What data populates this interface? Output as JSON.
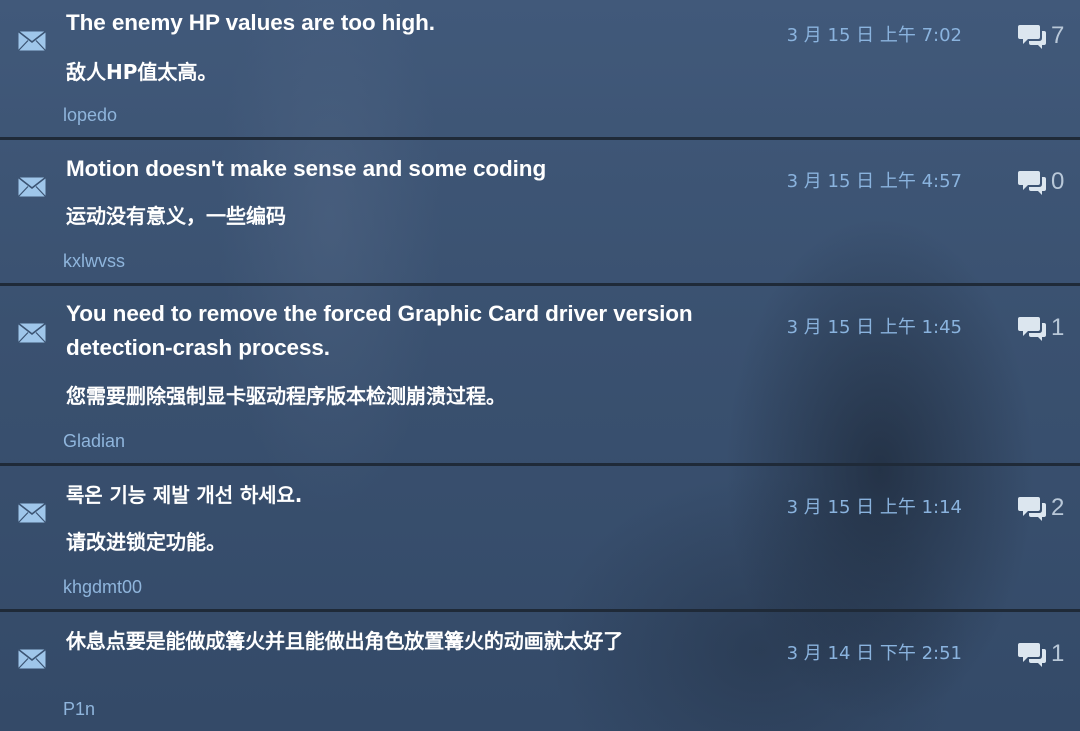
{
  "threads": [
    {
      "title": "The enemy HP values are too high.",
      "translation": "敌人HP值太高。",
      "author": "lopedo",
      "date": "3 月 15 日 上午 7:02",
      "replies": "7"
    },
    {
      "title": "Motion doesn't make sense and some coding",
      "translation": "运动没有意义，一些编码",
      "author": "kxlwvss",
      "date": "3 月 15 日 上午 4:57",
      "replies": "0"
    },
    {
      "title": "You need to remove the forced Graphic Card driver version detection-crash process.",
      "translation": "您需要删除强制显卡驱动程序版本检测崩溃过程。",
      "author": "Gladian",
      "date": "3 月 15 日 上午 1:45",
      "replies": "1"
    },
    {
      "title": "록온 기능 제발 개선 하세요.",
      "translation": "请改进锁定功能。",
      "author": "khgdmt00",
      "date": "3 月 15 日 上午 1:14",
      "replies": "2"
    },
    {
      "title": "休息点要是能做成篝火并且能做出角色放置篝火的动画就太好了",
      "translation": "",
      "author": "P1n",
      "date": "3 月 14 日 下午 2:51",
      "replies": "1"
    }
  ],
  "colors": {
    "author": "#8fb5dc",
    "date": "#8ab3de",
    "divider": "#1f2a38",
    "icon": "#9fc6ea"
  },
  "icons": {
    "unread": "envelope-icon",
    "replies": "speech-bubbles-icon"
  }
}
